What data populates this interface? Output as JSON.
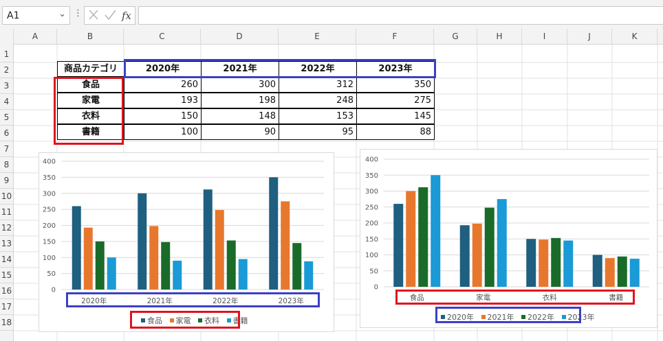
{
  "formula_bar": {
    "name_box": "A1",
    "formula": "",
    "fx_label": "fx",
    "cancel_icon": "close-icon",
    "enter_icon": "check-icon"
  },
  "columns": [
    "A",
    "B",
    "C",
    "D",
    "E",
    "F",
    "G",
    "H",
    "I",
    "J",
    "K"
  ],
  "rows": [
    "1",
    "2",
    "3",
    "4",
    "5",
    "6",
    "7",
    "8",
    "9",
    "10",
    "11",
    "12",
    "13",
    "14",
    "15",
    "16",
    "17",
    "18"
  ],
  "table": {
    "corner": "商品カテゴリ",
    "years": [
      "2020年",
      "2021年",
      "2022年",
      "2023年"
    ],
    "rows": [
      {
        "label": "食品",
        "values": [
          "260",
          "300",
          "312",
          "350"
        ]
      },
      {
        "label": "家電",
        "values": [
          "193",
          "198",
          "248",
          "275"
        ]
      },
      {
        "label": "衣料",
        "values": [
          "150",
          "148",
          "153",
          "145"
        ]
      },
      {
        "label": "書籍",
        "values": [
          "100",
          "90",
          "95",
          "88"
        ]
      }
    ]
  },
  "colors": {
    "series": [
      "#1f5f80",
      "#e8772e",
      "#1a6b2a",
      "#1a9ad6"
    ],
    "highlight_red": "#e0121c",
    "highlight_blue": "#3b3fc7"
  },
  "chart_data": [
    {
      "type": "bar",
      "categories": [
        "2020年",
        "2021年",
        "2022年",
        "2023年"
      ],
      "series": [
        {
          "name": "食品",
          "values": [
            260,
            300,
            312,
            350
          ]
        },
        {
          "name": "家電",
          "values": [
            193,
            198,
            248,
            275
          ]
        },
        {
          "name": "衣料",
          "values": [
            150,
            148,
            153,
            145
          ]
        },
        {
          "name": "書籍",
          "values": [
            100,
            90,
            95,
            88
          ]
        }
      ],
      "ylim": [
        0,
        400
      ],
      "yticks": [
        "0",
        "50",
        "100",
        "150",
        "200",
        "250",
        "300",
        "350",
        "400"
      ],
      "legend": "bottom",
      "grid": true
    },
    {
      "type": "bar",
      "categories": [
        "食品",
        "家電",
        "衣料",
        "書籍"
      ],
      "series": [
        {
          "name": "2020年",
          "values": [
            260,
            193,
            150,
            100
          ]
        },
        {
          "name": "2021年",
          "values": [
            300,
            198,
            148,
            90
          ]
        },
        {
          "name": "2022年",
          "values": [
            312,
            248,
            153,
            95
          ]
        },
        {
          "name": "2023年",
          "values": [
            350,
            275,
            145,
            88
          ]
        }
      ],
      "ylim": [
        0,
        400
      ],
      "yticks": [
        "0",
        "50",
        "100",
        "150",
        "200",
        "250",
        "300",
        "350",
        "400"
      ],
      "legend": "bottom",
      "grid": true
    }
  ]
}
